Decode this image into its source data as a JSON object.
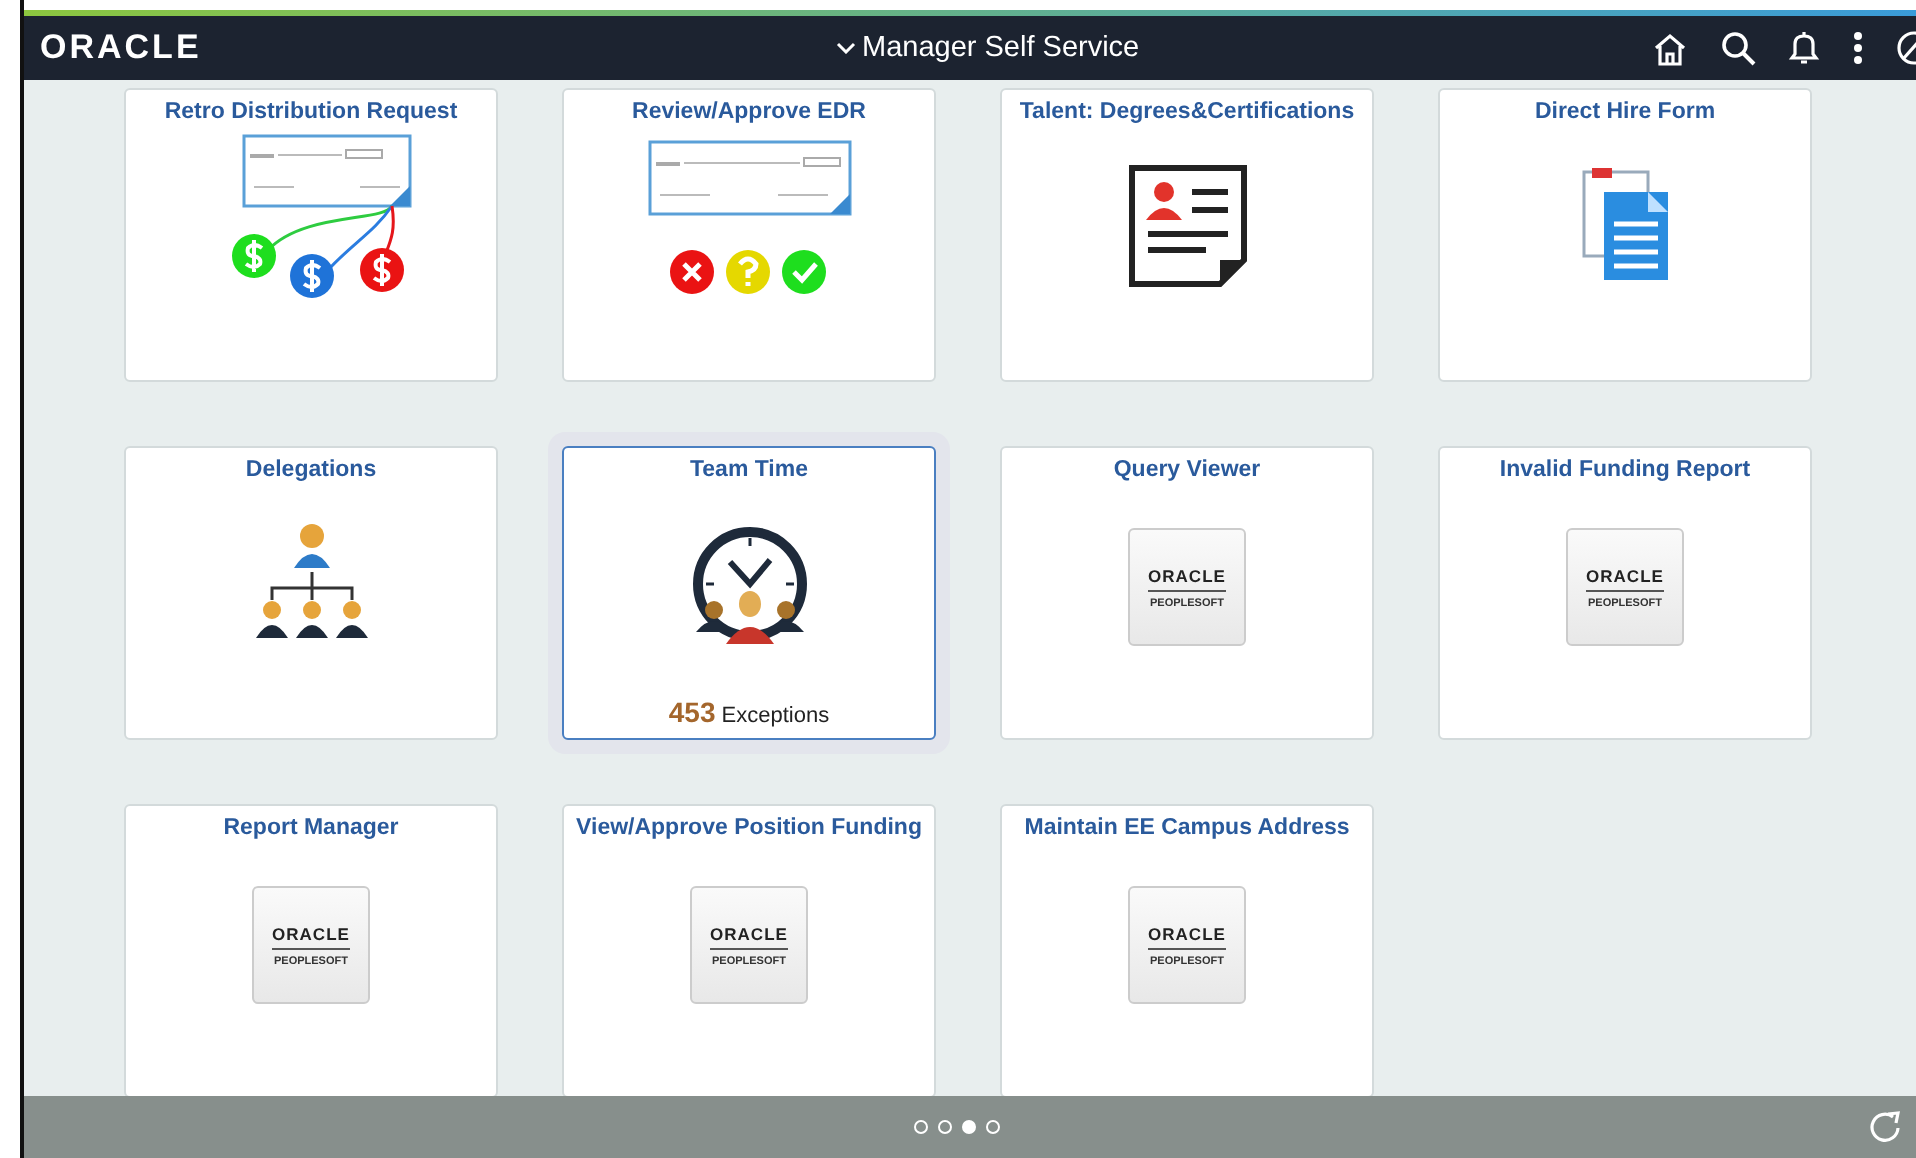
{
  "header": {
    "logo": "ORACLE",
    "title": "Manager Self Service"
  },
  "tiles": [
    {
      "title": "Retro Distribution Request",
      "kind": "check-split",
      "selected": false
    },
    {
      "title": "Review/Approve EDR",
      "kind": "check-review",
      "selected": false
    },
    {
      "title": "Talent: Degrees&Certifications",
      "kind": "certificate",
      "selected": false
    },
    {
      "title": "Direct Hire Form",
      "kind": "document",
      "selected": false
    },
    {
      "title": "Delegations",
      "kind": "org-chart",
      "selected": false
    },
    {
      "title": "Team Time",
      "kind": "clock-team",
      "selected": true,
      "count": "453",
      "count_label": "Exceptions"
    },
    {
      "title": "Query Viewer",
      "kind": "logo",
      "logo": "ORACLE",
      "logo_sub": "PEOPLESOFT",
      "selected": false
    },
    {
      "title": "Invalid Funding Report",
      "kind": "logo",
      "logo": "ORACLE",
      "logo_sub": "PEOPLESOFT",
      "selected": false
    },
    {
      "title": "Report Manager",
      "kind": "logo",
      "logo": "ORACLE",
      "logo_sub": "PEOPLESOFT",
      "selected": false
    },
    {
      "title": "View/Approve Position Funding",
      "kind": "logo",
      "logo": "ORACLE",
      "logo_sub": "PEOPLESOFT",
      "selected": false
    },
    {
      "title": "Maintain EE Campus Address",
      "kind": "logo",
      "logo": "ORACLE",
      "logo_sub": "PEOPLESOFT",
      "selected": false
    }
  ],
  "pages": [
    {
      "selected": false
    },
    {
      "selected": false
    },
    {
      "selected": true
    },
    {
      "selected": false
    }
  ]
}
